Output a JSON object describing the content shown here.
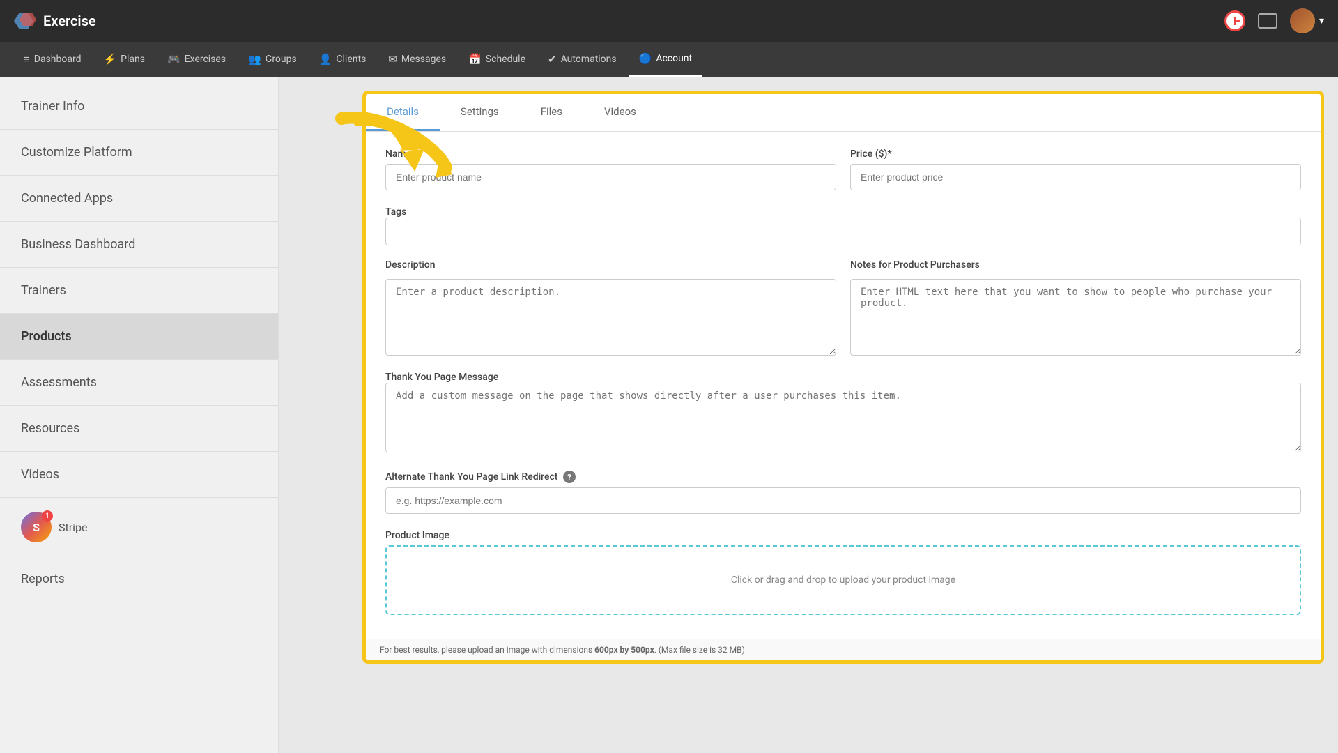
{
  "app": {
    "name": "Exercise",
    "logo_alt": "exercise-logo"
  },
  "navbar": {
    "items": [
      {
        "id": "dashboard",
        "label": "Dashboard",
        "icon": "≡"
      },
      {
        "id": "plans",
        "label": "Plans",
        "icon": "⚡"
      },
      {
        "id": "exercises",
        "label": "Exercises",
        "icon": "🎮"
      },
      {
        "id": "groups",
        "label": "Groups",
        "icon": "👥"
      },
      {
        "id": "clients",
        "label": "Clients",
        "icon": "👤"
      },
      {
        "id": "messages",
        "label": "Messages",
        "icon": "✉"
      },
      {
        "id": "schedule",
        "label": "Schedule",
        "icon": "📅"
      },
      {
        "id": "automations",
        "label": "Automations",
        "icon": "✔"
      },
      {
        "id": "account",
        "label": "Account",
        "icon": "🔵"
      }
    ]
  },
  "sidebar": {
    "items": [
      {
        "id": "trainer-info",
        "label": "Trainer Info"
      },
      {
        "id": "customize-platform",
        "label": "Customize Platform"
      },
      {
        "id": "connected-apps",
        "label": "Connected Apps"
      },
      {
        "id": "business-dashboard",
        "label": "Business Dashboard"
      },
      {
        "id": "trainers",
        "label": "Trainers"
      },
      {
        "id": "products",
        "label": "Products",
        "active": true
      },
      {
        "id": "assessments",
        "label": "Assessments"
      },
      {
        "id": "resources",
        "label": "Resources"
      },
      {
        "id": "videos",
        "label": "Videos"
      },
      {
        "id": "reports",
        "label": "Reports"
      }
    ],
    "stripe_label": "Stripe"
  },
  "tabs": [
    {
      "id": "details",
      "label": "Details",
      "active": true
    },
    {
      "id": "settings",
      "label": "Settings"
    },
    {
      "id": "files",
      "label": "Files"
    },
    {
      "id": "videos",
      "label": "Videos"
    }
  ],
  "form": {
    "name_label": "Name*",
    "name_placeholder": "Enter product name",
    "price_label": "Price ($)*",
    "price_placeholder": "Enter product price",
    "tags_label": "Tags",
    "description_label": "Description",
    "description_placeholder": "Enter a product description.",
    "notes_label": "Notes for Product Purchasers",
    "notes_placeholder": "Enter HTML text here that you want to show to people who purchase your product.",
    "thankyou_label": "Thank You Page Message",
    "thankyou_placeholder": "Add a custom message on the page that shows directly after a user purchases this item.",
    "redirect_label": "Alternate Thank You Page Link Redirect",
    "redirect_placeholder": "e.g. https://example.com",
    "image_label": "Product Image",
    "image_upload_text": "Click or drag and drop to upload your product image",
    "bottom_note": "For best results, please upload an image with dimensions 600px by 500px. (Max file size is 32 MB)"
  }
}
